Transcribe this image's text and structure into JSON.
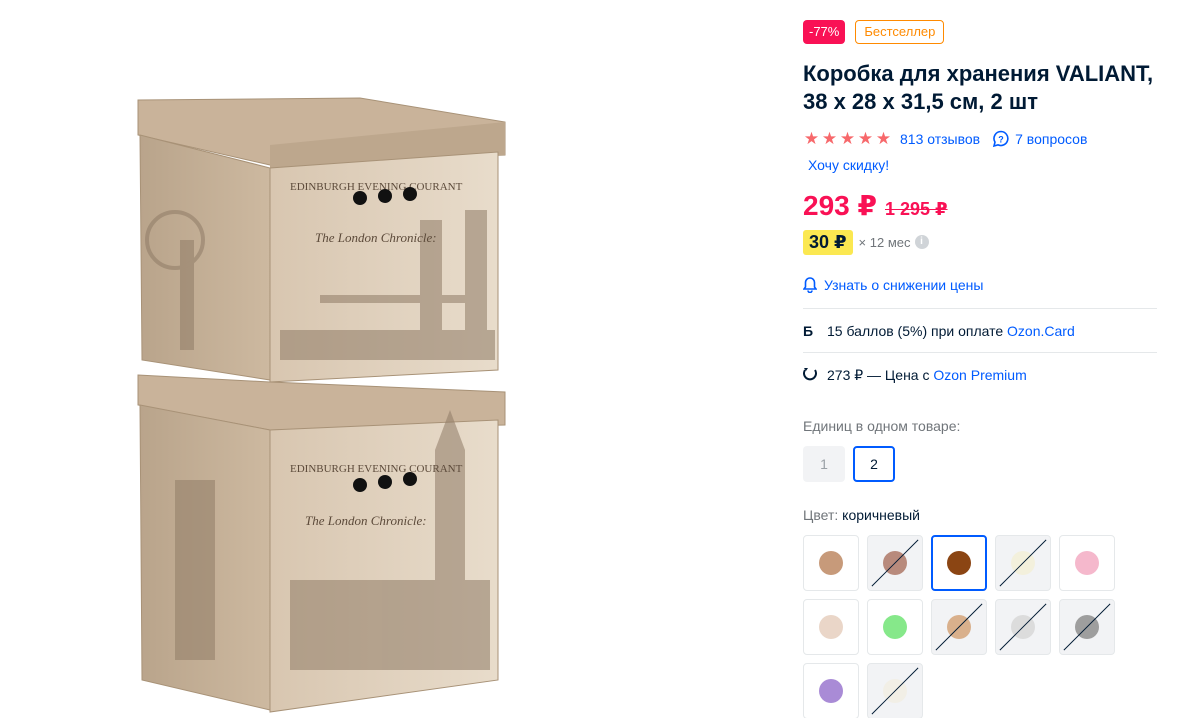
{
  "badges": {
    "discount": "-77%",
    "label": "Бестселлер"
  },
  "product": {
    "title": "Коробка для хранения VALIANT, 38 x 28 x 31,5 см, 2 шт",
    "rating": 5,
    "reviews_label": "813 отзывов",
    "questions_label": "7 вопросов",
    "discount_request": "Хочу скидку!",
    "price": "293 ₽",
    "old_price": "1 295 ₽",
    "installment_amount": "30 ₽",
    "installment_term": "× 12 мес",
    "notify_label": "Узнать о снижении цены",
    "bonus_text": "15 баллов (5%) при оплате ",
    "bonus_link": "Ozon.Card",
    "premium_text": "273 ₽ — Цена с ",
    "premium_link": "Ozon Premium"
  },
  "image": {
    "box_top_text1": "EDINBURGH EVENING COURANT",
    "box_top_text2": "The London Chronicle:",
    "box_bottom_text1": "EDINBURGH EVENING COURANT",
    "box_bottom_text2": "The London Chronicle:"
  },
  "units": {
    "label": "Единиц в одном товаре:",
    "options": [
      "1",
      "2"
    ],
    "selected": "2"
  },
  "color": {
    "label": "Цвет:",
    "value": "коричневый",
    "swatches": [
      {
        "color": "#c79a7a",
        "available": true,
        "selected": false
      },
      {
        "color": "#b88a7c",
        "available": false,
        "selected": false
      },
      {
        "color": "#8b4513",
        "available": true,
        "selected": true
      },
      {
        "color": "#f3f0dc",
        "available": false,
        "selected": false
      },
      {
        "color": "#f5b8cc",
        "available": true,
        "selected": false
      },
      {
        "color": "#ead6c8",
        "available": true,
        "selected": false
      },
      {
        "color": "#86e88a",
        "available": true,
        "selected": false
      },
      {
        "color": "#d9b08c",
        "available": false,
        "selected": false
      },
      {
        "color": "#dcdcdc",
        "available": false,
        "selected": false
      },
      {
        "color": "#9e9e9e",
        "available": false,
        "selected": false
      },
      {
        "color": "#a98bd6",
        "available": true,
        "selected": false
      },
      {
        "color": "#f2efe6",
        "available": false,
        "selected": false
      }
    ]
  },
  "colors": {
    "accent": "#005bff",
    "sale": "#f91155",
    "installment": "#fbe851",
    "bestseller": "#ff8a00"
  }
}
